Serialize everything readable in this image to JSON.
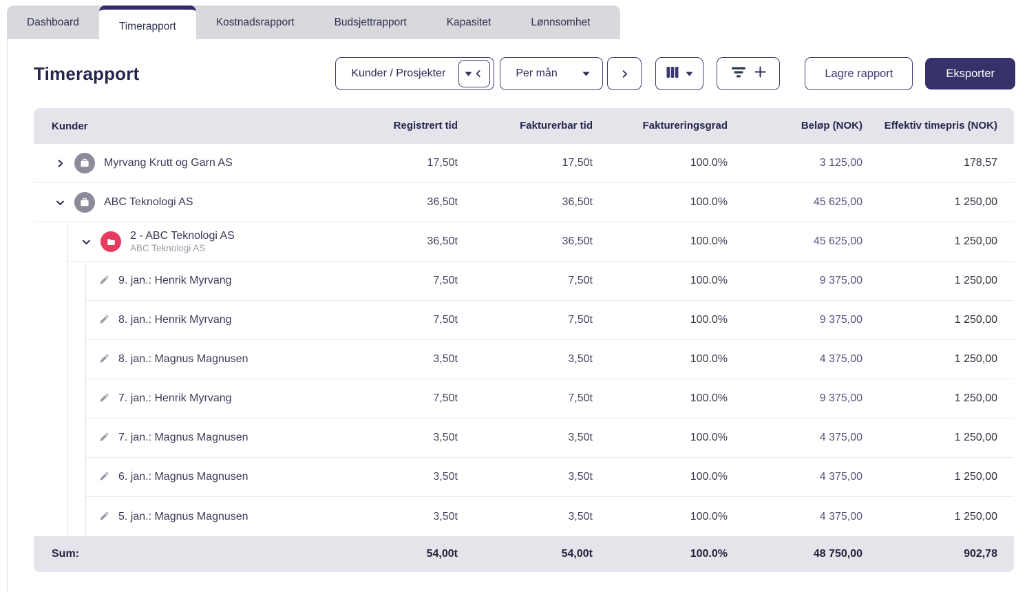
{
  "colors": {
    "accent_navy": "#312d66",
    "export_bg": "#363168",
    "tabbar_bg": "#d8d8dd",
    "header_bg": "#e4e4ea",
    "project_red": "#e83a5f",
    "customer_gray": "#8b8b99"
  },
  "tabs": [
    {
      "label": "Dashboard",
      "active": false
    },
    {
      "label": "Timerapport",
      "active": true
    },
    {
      "label": "Kostnadsrapport",
      "active": false
    },
    {
      "label": "Budsjettrapport",
      "active": false
    },
    {
      "label": "Kapasitet",
      "active": false
    },
    {
      "label": "Lønnsomhet",
      "active": false
    }
  ],
  "page": {
    "title": "Timerapport"
  },
  "toolbar": {
    "grouping_select": {
      "value": "Kunder / Prosjekter"
    },
    "period_select": {
      "value": "Per mån"
    },
    "save_label": "Lagre rapport",
    "export_label": "Eksporter"
  },
  "table": {
    "columns": {
      "name": "Kunder",
      "registrert": "Registrert tid",
      "fakturerbar": "Fakturerbar tid",
      "grad": "Faktureringsgrad",
      "belop": "Beløp (NOK)",
      "timepris": "Effektiv timepris (NOK)"
    },
    "rows": [
      {
        "type": "customer",
        "expanded": false,
        "icon": "briefcase-icon",
        "name": "Myrvang Krutt og Garn AS",
        "registrert": "17,50t",
        "fakturerbar": "17,50t",
        "grad": "100.0%",
        "belop": "3 125,00",
        "timepris": "178,57"
      },
      {
        "type": "customer",
        "expanded": true,
        "icon": "briefcase-icon",
        "name": "ABC Teknologi AS",
        "registrert": "36,50t",
        "fakturerbar": "36,50t",
        "grad": "100.0%",
        "belop": "45 625,00",
        "timepris": "1 250,00"
      },
      {
        "type": "project",
        "expanded": true,
        "icon": "folder-icon",
        "name": "2 - ABC Teknologi AS",
        "subtitle": "ABC Teknologi AS",
        "registrert": "36,50t",
        "fakturerbar": "36,50t",
        "grad": "100.0%",
        "belop": "45 625,00",
        "timepris": "1 250,00"
      },
      {
        "type": "entry",
        "icon": "pencil-icon",
        "name": "9. jan.: Henrik Myrvang",
        "registrert": "7,50t",
        "fakturerbar": "7,50t",
        "grad": "100.0%",
        "belop": "9 375,00",
        "timepris": "1 250,00"
      },
      {
        "type": "entry",
        "icon": "pencil-icon",
        "name": "8. jan.: Henrik Myrvang",
        "registrert": "7,50t",
        "fakturerbar": "7,50t",
        "grad": "100.0%",
        "belop": "9 375,00",
        "timepris": "1 250,00"
      },
      {
        "type": "entry",
        "icon": "pencil-icon",
        "name": "8. jan.: Magnus Magnusen",
        "registrert": "3,50t",
        "fakturerbar": "3,50t",
        "grad": "100.0%",
        "belop": "4 375,00",
        "timepris": "1 250,00"
      },
      {
        "type": "entry",
        "icon": "pencil-icon",
        "name": "7. jan.: Henrik Myrvang",
        "registrert": "7,50t",
        "fakturerbar": "7,50t",
        "grad": "100.0%",
        "belop": "9 375,00",
        "timepris": "1 250,00"
      },
      {
        "type": "entry",
        "icon": "pencil-icon",
        "name": "7. jan.: Magnus Magnusen",
        "registrert": "3,50t",
        "fakturerbar": "3,50t",
        "grad": "100.0%",
        "belop": "4 375,00",
        "timepris": "1 250,00"
      },
      {
        "type": "entry",
        "icon": "pencil-icon",
        "name": "6. jan.: Magnus Magnusen",
        "registrert": "3,50t",
        "fakturerbar": "3,50t",
        "grad": "100.0%",
        "belop": "4 375,00",
        "timepris": "1 250,00"
      },
      {
        "type": "entry",
        "icon": "pencil-icon",
        "name": "5. jan.: Magnus Magnusen",
        "registrert": "3,50t",
        "fakturerbar": "3,50t",
        "grad": "100.0%",
        "belop": "4 375,00",
        "timepris": "1 250,00"
      }
    ],
    "sum": {
      "label": "Sum:",
      "registrert": "54,00t",
      "fakturerbar": "54,00t",
      "grad": "100.0%",
      "belop": "48 750,00",
      "timepris": "902,78"
    }
  }
}
